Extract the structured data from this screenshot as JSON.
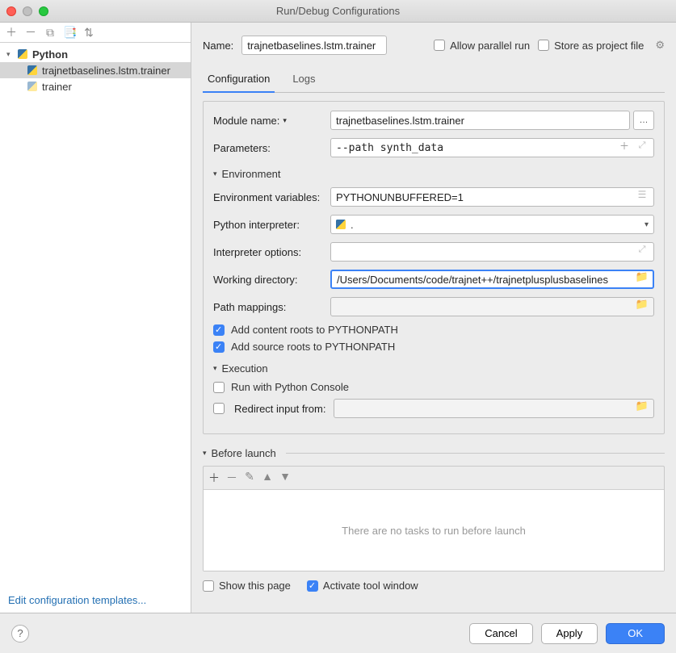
{
  "window": {
    "title": "Run/Debug Configurations"
  },
  "tree": {
    "group": "Python",
    "items": [
      {
        "label": "trajnetbaselines.lstm.trainer",
        "selected": true
      },
      {
        "label": "trainer",
        "selected": false
      }
    ],
    "edit_templates": "Edit configuration templates..."
  },
  "topbar": {
    "name_label": "Name:",
    "name_value": "trajnetbaselines.lstm.trainer",
    "allow_parallel": "Allow parallel run",
    "store_project": "Store as project file"
  },
  "tabs": {
    "configuration": "Configuration",
    "logs": "Logs"
  },
  "form": {
    "module_name_label": "Module name:",
    "module_name_value": "trajnetbaselines.lstm.trainer",
    "parameters_label": "Parameters:",
    "parameters_value": "--path synth_data",
    "environment_header": "Environment",
    "env_vars_label": "Environment variables:",
    "env_vars_value": "PYTHONUNBUFFERED=1",
    "interpreter_label": "Python interpreter:",
    "interpreter_value": ".",
    "interpreter_opts_label": "Interpreter options:",
    "interpreter_opts_value": "",
    "working_dir_label": "Working directory:",
    "working_dir_value": "/Users/Documents/code/trajnet++/trajnetplusplusbaselines",
    "path_mappings_label": "Path mappings:",
    "path_mappings_value": "",
    "add_content_roots": "Add content roots to PYTHONPATH",
    "add_source_roots": "Add source roots to PYTHONPATH",
    "execution_header": "Execution",
    "run_console": "Run with Python Console",
    "redirect_input_label": "Redirect input from:",
    "redirect_input_value": ""
  },
  "before_launch": {
    "header": "Before launch",
    "empty": "There are no tasks to run before launch"
  },
  "bottom": {
    "show_page": "Show this page",
    "activate_tool": "Activate tool window"
  },
  "footer": {
    "cancel": "Cancel",
    "apply": "Apply",
    "ok": "OK"
  }
}
